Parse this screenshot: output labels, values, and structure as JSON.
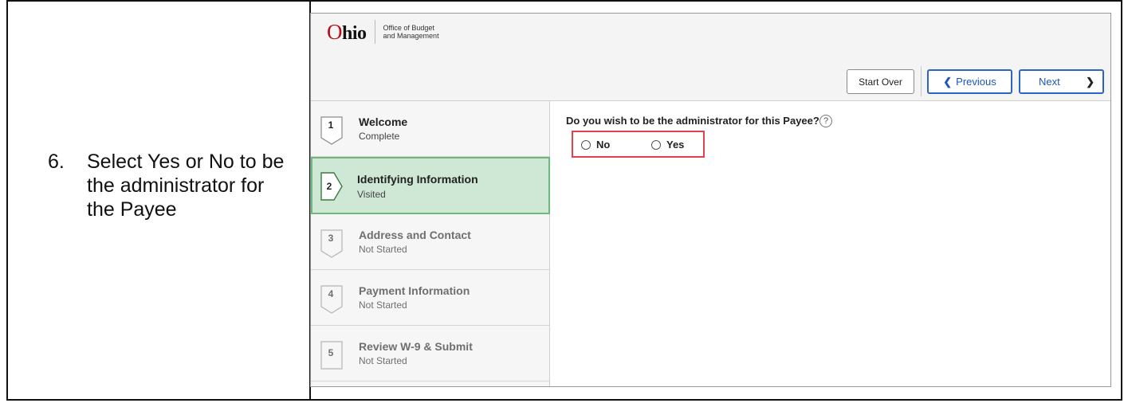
{
  "instruction": {
    "number": "6.",
    "text": "Select Yes or No to be the administrator for the Payee"
  },
  "header": {
    "logo_word_first": "O",
    "logo_word_rest": "hio",
    "logo_sub_line1": "Office of Budget",
    "logo_sub_line2": "and Management",
    "start_over_label": "Start Over",
    "previous_label": "Previous",
    "next_label": "Next"
  },
  "steps": [
    {
      "number": "1",
      "title": "Welcome",
      "status": "Complete"
    },
    {
      "number": "2",
      "title": "Identifying Information",
      "status": "Visited"
    },
    {
      "number": "3",
      "title": "Address and Contact",
      "status": "Not Started"
    },
    {
      "number": "4",
      "title": "Payment Information",
      "status": "Not Started"
    },
    {
      "number": "5",
      "title": "Review W-9 & Submit",
      "status": "Not Started"
    }
  ],
  "form": {
    "question": "Do you wish to be the administrator for this Payee?",
    "help_glyph": "?",
    "options": [
      "No",
      "Yes"
    ]
  },
  "colors": {
    "accent_blue": "#2a64c4",
    "active_step_bg": "#cfe8d5",
    "highlight_red": "#e0434c",
    "ohio_red": "#b4131b"
  }
}
